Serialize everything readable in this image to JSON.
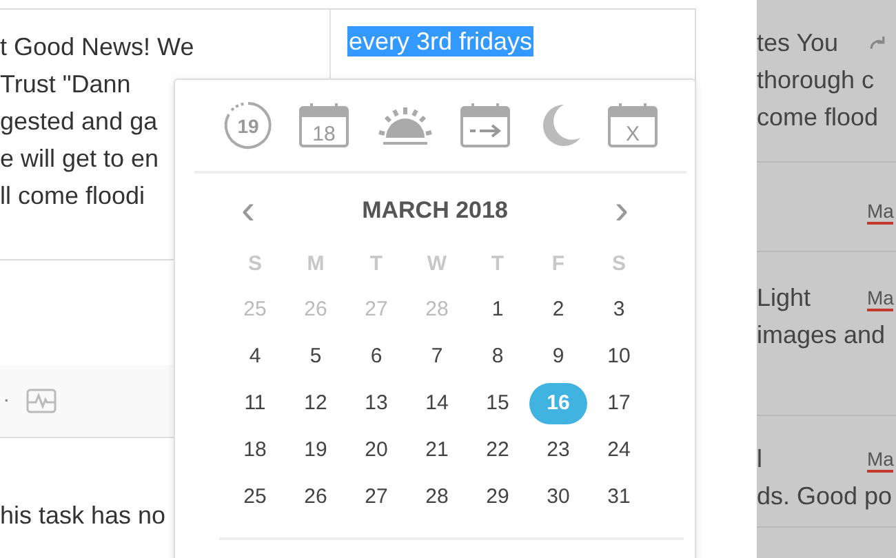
{
  "note_lines": [
    "t Good News! We",
    "Trust \"Dann",
    "gested and ga",
    "e will get to en",
    "ll come floodi"
  ],
  "repeat_field": {
    "value": "every 3rd fridays",
    "selected": true
  },
  "band": {
    "dot": "·"
  },
  "empty_message": "his task has no",
  "date_picker": {
    "shortcuts": [
      {
        "kind": "clock",
        "label": "19"
      },
      {
        "kind": "calendar",
        "label": "18"
      },
      {
        "kind": "sunrise"
      },
      {
        "kind": "arrow"
      },
      {
        "kind": "moon"
      },
      {
        "kind": "calendar",
        "label": "X"
      }
    ],
    "prev": "‹",
    "month": "MARCH 2018",
    "next": "›",
    "weekdays": [
      "S",
      "M",
      "T",
      "W",
      "T",
      "F",
      "S"
    ],
    "weeks": [
      [
        {
          "day": "25",
          "muted": true,
          "selected": false
        },
        {
          "day": "26",
          "muted": true,
          "selected": false
        },
        {
          "day": "27",
          "muted": true,
          "selected": false
        },
        {
          "day": "28",
          "muted": true,
          "selected": false
        },
        {
          "day": "1",
          "muted": false,
          "selected": false
        },
        {
          "day": "2",
          "muted": false,
          "selected": false
        },
        {
          "day": "3",
          "muted": false,
          "selected": false
        }
      ],
      [
        {
          "day": "4",
          "muted": false,
          "selected": false
        },
        {
          "day": "5",
          "muted": false,
          "selected": false
        },
        {
          "day": "6",
          "muted": false,
          "selected": false
        },
        {
          "day": "7",
          "muted": false,
          "selected": false
        },
        {
          "day": "8",
          "muted": false,
          "selected": false
        },
        {
          "day": "9",
          "muted": false,
          "selected": false
        },
        {
          "day": "10",
          "muted": false,
          "selected": false
        }
      ],
      [
        {
          "day": "11",
          "muted": false,
          "selected": false
        },
        {
          "day": "12",
          "muted": false,
          "selected": false
        },
        {
          "day": "13",
          "muted": false,
          "selected": false
        },
        {
          "day": "14",
          "muted": false,
          "selected": false
        },
        {
          "day": "15",
          "muted": false,
          "selected": false
        },
        {
          "day": "16",
          "muted": false,
          "selected": true
        },
        {
          "day": "17",
          "muted": false,
          "selected": false
        }
      ],
      [
        {
          "day": "18",
          "muted": false,
          "selected": false
        },
        {
          "day": "19",
          "muted": false,
          "selected": false
        },
        {
          "day": "20",
          "muted": false,
          "selected": false
        },
        {
          "day": "21",
          "muted": false,
          "selected": false
        },
        {
          "day": "22",
          "muted": false,
          "selected": false
        },
        {
          "day": "23",
          "muted": false,
          "selected": false
        },
        {
          "day": "24",
          "muted": false,
          "selected": false
        }
      ],
      [
        {
          "day": "25",
          "muted": false,
          "selected": false
        },
        {
          "day": "26",
          "muted": false,
          "selected": false
        },
        {
          "day": "27",
          "muted": false,
          "selected": false
        },
        {
          "day": "28",
          "muted": false,
          "selected": false
        },
        {
          "day": "29",
          "muted": false,
          "selected": false
        },
        {
          "day": "30",
          "muted": false,
          "selected": false
        },
        {
          "day": "31",
          "muted": false,
          "selected": false
        }
      ]
    ]
  },
  "task_list": [
    {
      "lines": [
        "tes You",
        "thorough c",
        "come flood"
      ],
      "repeat_icon": true
    },
    {
      "date": "Ma",
      "repeat_icon": false
    },
    {
      "lines": [
        "Light",
        "images and"
      ],
      "date": "Ma",
      "repeat_icon": false
    },
    {
      "lines": [
        "l",
        "ds. Good po"
      ],
      "date": "Ma",
      "repeat_icon": false
    }
  ]
}
